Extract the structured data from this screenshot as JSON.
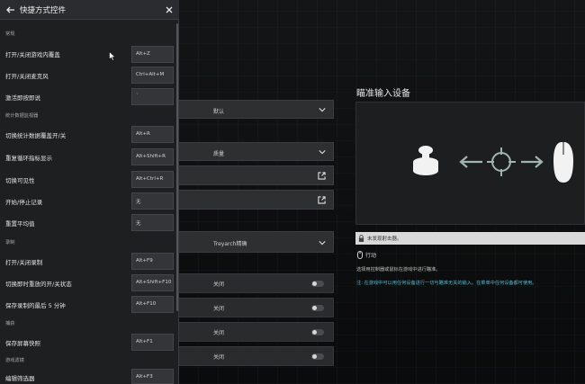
{
  "panel": {
    "title": "快捷方式控件",
    "sections": {
      "general": "常规",
      "stats": "统计数据监视器",
      "record": "录制",
      "capture": "捕获",
      "filters": "游戏滤镜"
    },
    "rows": [
      {
        "label": "打开/关闭游戏内覆盖",
        "key": "Alt+Z"
      },
      {
        "label": "打开/关闭麦克风",
        "key": "Ctrl+Alt+M"
      },
      {
        "label": "激活即按即说",
        "key": "`"
      },
      {
        "label": "切换统计数据覆盖开/关",
        "key": "Alt+R"
      },
      {
        "label": "重复循环指标显示",
        "key": "Alt+Shift+R"
      },
      {
        "label": "切换可见性",
        "key": "Alt+Ctrl+R"
      },
      {
        "label": "开始/停止记录",
        "key": "无"
      },
      {
        "label": "重置平均值",
        "key": "无"
      },
      {
        "label": "打开/关闭录制",
        "key": "Alt+F9"
      },
      {
        "label": "切换即时重放的开/关状态",
        "key": "Alt+Shift+F10"
      },
      {
        "label": "保存录制的最后 5 分钟",
        "key": "Alt+F10"
      },
      {
        "label": "保存屏幕快照",
        "key": "Alt+F1"
      },
      {
        "label": "编辑筛选器",
        "key": "Alt+F3"
      }
    ]
  },
  "main": {
    "dropdown_1": "默认",
    "dropdown_2": "质量",
    "dropdown_3": "Treyarch精确",
    "toggles": [
      "关闭",
      "关闭",
      "关闭",
      "关闭"
    ]
  },
  "right": {
    "title": "瞄准输入设备",
    "status": "未发现射击器。",
    "action": "行动",
    "desc": "选择用控制器或鼠标在游戏中进行瞄准。",
    "note": "注: 在游戏中可以用任何设备进行一切与瞄准无关的输入。在菜单中任何设备都可使用。"
  },
  "colors": {
    "accent": "#5fb7c9",
    "panel_bg": "#1e1f21"
  }
}
